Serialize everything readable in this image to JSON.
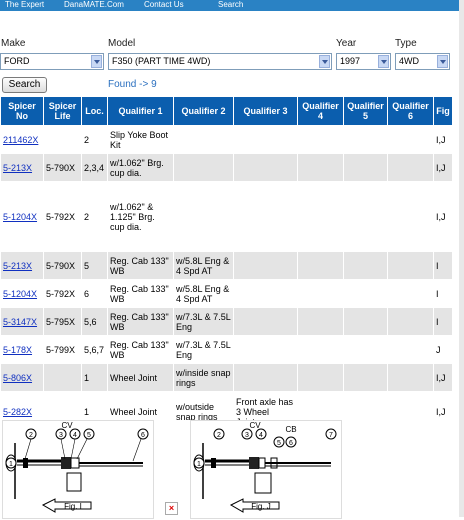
{
  "nav": {
    "items": [
      "The Expert",
      "DanaMATE.Com",
      "Contact Us",
      "Search"
    ]
  },
  "form": {
    "make": {
      "label": "Make",
      "value": "FORD"
    },
    "model": {
      "label": "Model",
      "value": "F350 (PART TIME 4WD)"
    },
    "year": {
      "label": "Year",
      "value": "1997"
    },
    "type": {
      "label": "Type",
      "value": "4WD"
    },
    "search_label": "Search",
    "found_text": "Found -> 9"
  },
  "table": {
    "headers": [
      "Spicer No",
      "Spicer Life",
      "Loc.",
      "Qualifier 1",
      "Qualifier 2",
      "Qualifier 3",
      "Qualifier 4",
      "Qualifier 5",
      "Qualifier 6",
      "Fig"
    ],
    "rows": [
      {
        "spicer_no": "211462X",
        "life": "",
        "loc": "2",
        "q1": "Slip Yoke Boot Kit",
        "q2": "",
        "q3": "",
        "fig": "I,J"
      },
      {
        "spicer_no": "5-213X",
        "life": "5-790X",
        "loc": "2,3,4",
        "q1": "w/1.062\" Brg. cup dia.",
        "q2": "",
        "q3": "",
        "fig": "I,J"
      },
      {
        "spicer_no": "5-1204X",
        "life": "5-792X",
        "loc": "2",
        "q1": "w/1.062\" & 1.125\" Brg. cup dia.",
        "q2": "",
        "q3": "",
        "fig": "I,J"
      },
      {
        "spicer_no": "5-213X",
        "life": "5-790X",
        "loc": "5",
        "q1": "Reg. Cab 133\" WB",
        "q2": "w/5.8L Eng & 4 Spd AT",
        "q3": "",
        "fig": "I"
      },
      {
        "spicer_no": "5-1204X",
        "life": "5-792X",
        "loc": "6",
        "q1": "Reg. Cab 133\" WB",
        "q2": "w/5.8L Eng & 4 Spd AT",
        "q3": "",
        "fig": "I"
      },
      {
        "spicer_no": "5-3147X",
        "life": "5-795X",
        "loc": "5,6",
        "q1": "Reg. Cab 133\" WB",
        "q2": "w/7.3L & 7.5L Eng",
        "q3": "",
        "fig": "I"
      },
      {
        "spicer_no": "5-178X",
        "life": "5-799X",
        "loc": "5,6,7",
        "q1": "Reg. Cab 133\" WB",
        "q2": "w/7.3L & 7.5L Eng",
        "q3": "",
        "fig": "J"
      },
      {
        "spicer_no": "5-806X",
        "life": "",
        "loc": "1",
        "q1": "Wheel Joint",
        "q2": "w/inside snap rings",
        "q3": "",
        "fig": "I,J"
      },
      {
        "spicer_no": "5-282X",
        "life": "",
        "loc": "1",
        "q1": "Wheel Joint",
        "q2": "w/outside snap rings",
        "q3": "Front axle has 3 Wheel Joints",
        "fig": "I,J"
      }
    ]
  },
  "figures": {
    "fig_i": {
      "caption": "Fig. I",
      "callouts": [
        "1",
        "2",
        "3",
        "4",
        "5",
        "6"
      ],
      "cv": "CV"
    },
    "fig_j": {
      "caption": "Fig. J",
      "callouts": [
        "1",
        "2",
        "3",
        "4",
        "5",
        "6",
        "7"
      ],
      "cv": "CV",
      "cb": "CB"
    }
  }
}
